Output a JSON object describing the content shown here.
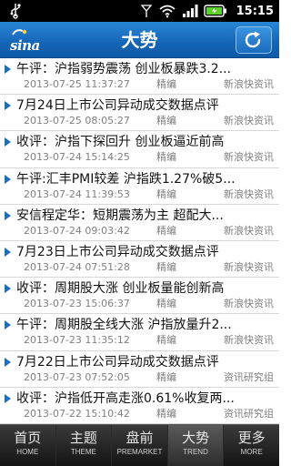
{
  "status_bar": {
    "time": "15:15",
    "icons": [
      "usb-icon",
      "signal-icon",
      "wifi-icon",
      "cell-signal-icon",
      "battery-icon"
    ]
  },
  "header": {
    "logo_text": "sina",
    "title": "大势",
    "refresh_icon": "refresh-icon"
  },
  "news": [
    {
      "headline": "午评：沪指弱势震荡 创业板暴跌3.2...",
      "date": "2013-07-25 11:37:27",
      "category": "精编",
      "source": "新浪快资讯"
    },
    {
      "headline": "7月24日上市公司异动成交数据点评",
      "date": "2013-07-25 08:05:27",
      "category": "精编",
      "source": "新浪快资讯"
    },
    {
      "headline": "收评：沪指下探回升 创业板逼近前高",
      "date": "2013-07-24 15:14:25",
      "category": "精编",
      "source": "新浪快资讯"
    },
    {
      "headline": "午评:汇丰PMI较差 沪指跌1.27%破5...",
      "date": "2013-07-24 11:39:53",
      "category": "精编",
      "source": "新浪快资讯"
    },
    {
      "headline": "安信程定华：短期震荡为主 超配大...",
      "date": "2013-07-24 09:03:42",
      "category": "精编",
      "source": "新浪快资讯"
    },
    {
      "headline": "7月23日上市公司异动成交数据点评",
      "date": "2013-07-24 07:51:28",
      "category": "精编",
      "source": "新浪快资讯"
    },
    {
      "headline": "收评：周期股大涨 创业板量能创新高",
      "date": "2013-07-23 15:06:37",
      "category": "精编",
      "source": "新浪快资讯"
    },
    {
      "headline": "午评：周期股全线大涨 沪指放量升2...",
      "date": "2013-07-23 11:35:12",
      "category": "精编",
      "source": "新浪快资讯"
    },
    {
      "headline": "7月22日上市公司异动成交数据点评",
      "date": "2013-07-23 07:52:05",
      "category": "精编",
      "source": "资讯研究组"
    },
    {
      "headline": "收评：沪指低开高走涨0.61%收复两...",
      "date": "2013-07-22 15:10:42",
      "category": "精编",
      "source": "资讯研究组"
    }
  ],
  "tabs": [
    {
      "zh": "首页",
      "en": "HOME"
    },
    {
      "zh": "主题",
      "en": "THEME"
    },
    {
      "zh": "盘前",
      "en": "PREMARKET"
    },
    {
      "zh": "大势",
      "en": "TREND"
    },
    {
      "zh": "更多",
      "en": "MORE"
    }
  ],
  "colors": {
    "header_blue": "#1565b7",
    "arrow_blue": "#1a6fc2",
    "tabbar_dark": "#141414",
    "meta_gray": "#808080"
  }
}
